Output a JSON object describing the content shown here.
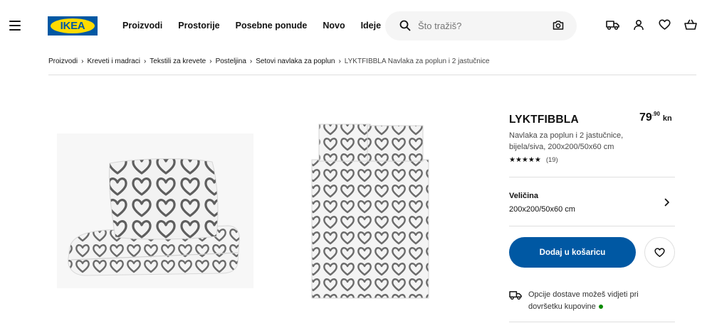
{
  "logo": "IKEA",
  "nav": [
    "Proizvodi",
    "Prostorije",
    "Posebne ponude",
    "Novo",
    "Ideje"
  ],
  "search": {
    "placeholder": "Što tražiš?"
  },
  "header_icons": [
    "truck-icon",
    "user-icon",
    "heart-icon",
    "cart-icon"
  ],
  "breadcrumb": {
    "items": [
      "Proizvodi",
      "Kreveti i madraci",
      "Tekstili za krevete",
      "Posteljina",
      "Setovi navlaka za poplun"
    ],
    "current": "LYKTFIBBLA Navlaka za poplun i 2 jastučnice"
  },
  "product": {
    "name": "LYKTFIBBLA",
    "price_int": "79",
    "price_dec": ".90",
    "currency": "kn",
    "description": "Navlaka za poplun i 2 jastučnice, bijela/siva, 200x200/50x60 cm",
    "stars": "★★★★★",
    "rating_count": "(19)",
    "size_label": "Veličina",
    "size_value": "200x200/50x60 cm",
    "add_to_cart": "Dodaj u košaricu",
    "delivery_text": "Opcije dostave možeš vidjeti pri dovršetku kupovine",
    "delivery_status_color": "#0a8a00"
  },
  "colors": {
    "brand_blue": "#0058a3",
    "brand_yellow": "#ffdb00"
  }
}
